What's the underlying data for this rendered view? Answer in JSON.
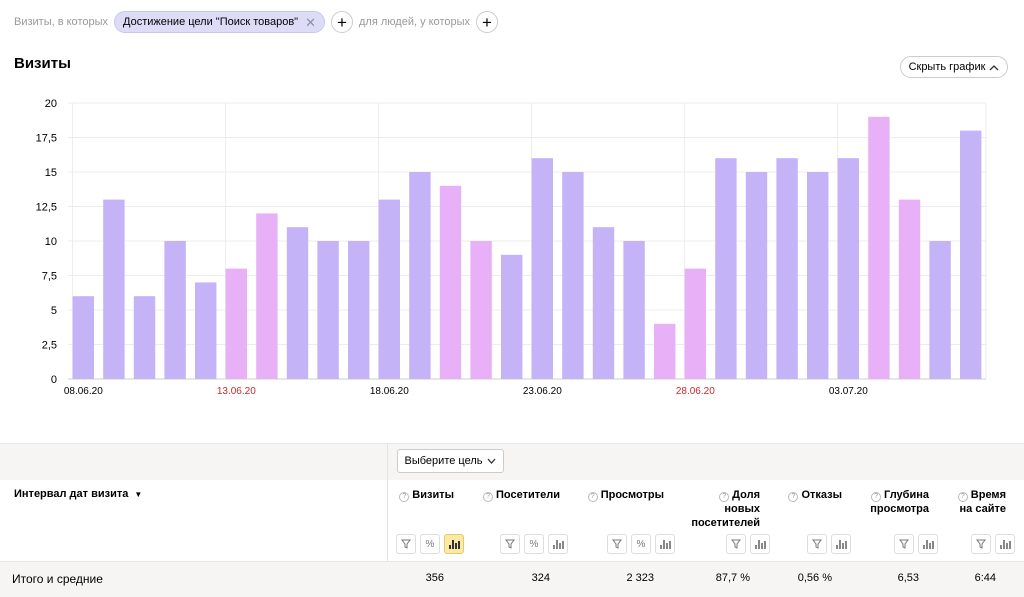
{
  "filter": {
    "prefix": "Визиты, в которых",
    "chip_label": "Достижение цели \"Поиск товаров\"",
    "middle": "для людей, у которых"
  },
  "section_title": "Визиты",
  "hide_chart_label": "Скрыть график",
  "chart_data": {
    "type": "bar",
    "ylim": [
      0,
      20
    ],
    "y_ticks": [
      "0",
      "2,5",
      "5",
      "7,5",
      "10",
      "12,5",
      "15",
      "17,5",
      "20"
    ],
    "x_labels": [
      {
        "index": 0,
        "text": "08.06.20",
        "weekend": false
      },
      {
        "index": 5,
        "text": "13.06.20",
        "weekend": true
      },
      {
        "index": 10,
        "text": "18.06.20",
        "weekend": false
      },
      {
        "index": 15,
        "text": "23.06.20",
        "weekend": false
      },
      {
        "index": 20,
        "text": "28.06.20",
        "weekend": true
      },
      {
        "index": 25,
        "text": "03.07.20",
        "weekend": false
      }
    ],
    "values": [
      6,
      13,
      6,
      10,
      7,
      8,
      12,
      11,
      10,
      10,
      13,
      15,
      14,
      10,
      9,
      16,
      15,
      11,
      10,
      4,
      8,
      16,
      15,
      16,
      15,
      16,
      19,
      13,
      10,
      18
    ],
    "weekend": [
      false,
      false,
      false,
      false,
      false,
      true,
      true,
      false,
      false,
      false,
      false,
      false,
      true,
      true,
      false,
      false,
      false,
      false,
      false,
      true,
      true,
      false,
      false,
      false,
      false,
      false,
      true,
      true,
      false,
      false
    ],
    "colors": {
      "weekday": "#c5b3f7",
      "weekend": "#e8b1f7",
      "weekend_label": "#cc2a2a"
    }
  },
  "table": {
    "goal_select_label": "Выберите цель",
    "dimension_header": "Интервал дат визита",
    "metrics": [
      {
        "line1": "Визиты",
        "line2": "",
        "line3": "",
        "total": "356"
      },
      {
        "line1": "Посетители",
        "line2": "",
        "line3": "",
        "total": "324"
      },
      {
        "line1": "Просмотры",
        "line2": "",
        "line3": "",
        "total": "2 323"
      },
      {
        "line1": "Доля",
        "line2": "новых",
        "line3": "посетителей",
        "total": "87,7 %"
      },
      {
        "line1": "Отказы",
        "line2": "",
        "line3": "",
        "total": "0,56 %"
      },
      {
        "line1": "Глубина",
        "line2": "просмотра",
        "line3": "",
        "total": "6,53"
      },
      {
        "line1": "Время",
        "line2": "на сайте",
        "line3": "",
        "total": "6:44"
      }
    ],
    "totals_label": "Итого и средние"
  }
}
